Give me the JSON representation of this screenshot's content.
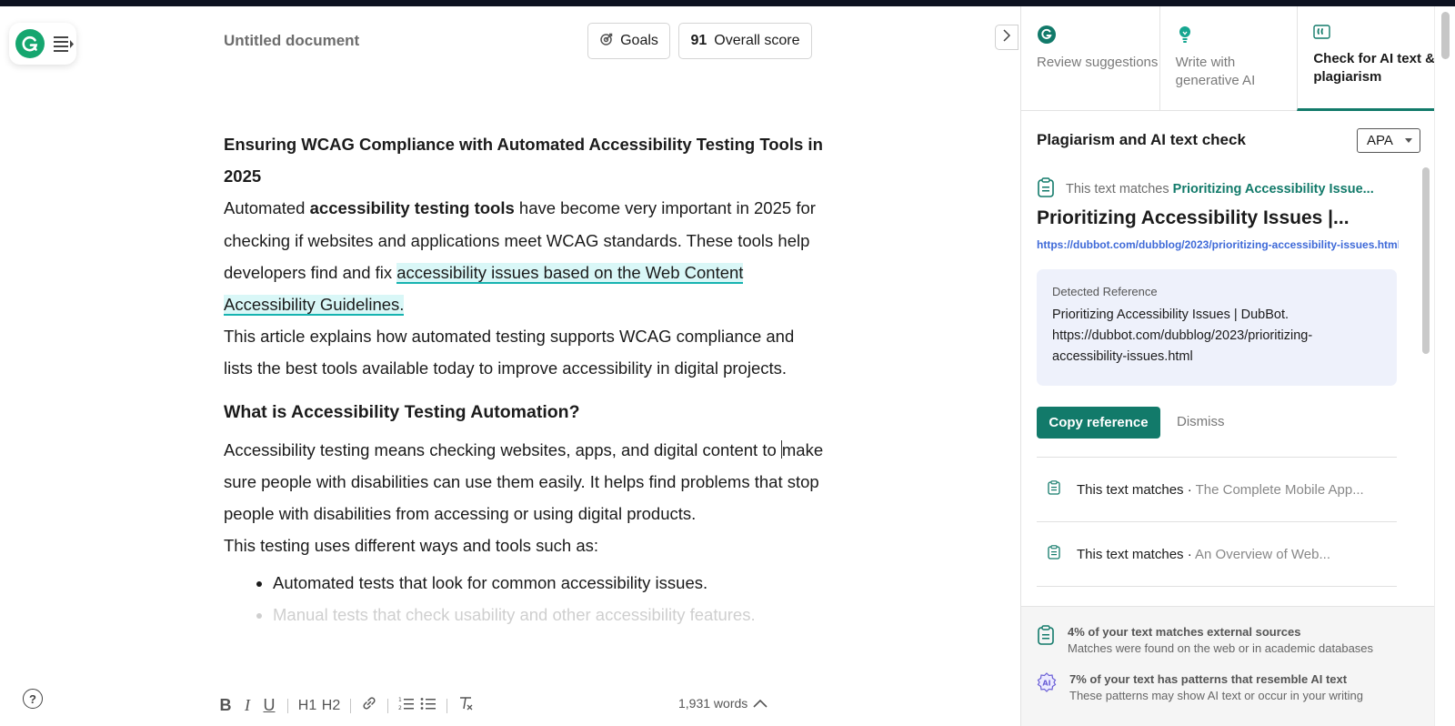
{
  "app": {
    "doc_title": "Untitled document",
    "goals_label": "Goals",
    "score_value": "91",
    "score_label": "Overall score"
  },
  "document": {
    "heading1": "Ensuring WCAG Compliance with Automated Accessibility Testing Tools in 2025",
    "p1_before": "Automated ",
    "p1_bold": "accessibility testing tools",
    "p1_middle": " have become very important in 2025 for checking if websites and applications meet WCAG standards. These tools help developers find and fix ",
    "p1_highlight": "accessibility issues based on the Web Content Accessibility Guidelines.",
    "p2": "This article explains how automated testing supports WCAG compliance and lists the best tools available today to improve accessibility in digital projects.",
    "heading2": "What is Accessibility Testing Automation?",
    "p3_before_cursor": "Accessibility testing means checking websites, apps, and digital content to ",
    "p3_after_cursor": "make sure people with disabilities can use them easily. It helps find problems that stop people with disabilities from accessing or using digital products.",
    "p4": "This testing uses different ways and tools such as:",
    "bullets": [
      "Automated tests that look for common accessibility issues.",
      "Manual tests that check usability and other accessibility features."
    ]
  },
  "toolbar": {
    "bold": "B",
    "italic": "I",
    "underline": "U",
    "h1": "H1",
    "h2": "H2",
    "word_count": "1,931 words"
  },
  "help": {
    "label": "?"
  },
  "panel": {
    "tabs": [
      {
        "label": "Review suggestions",
        "icon": "grammarly-g-icon"
      },
      {
        "label": "Write with generative AI",
        "icon": "lightbulb-icon"
      },
      {
        "label": "Check for AI text & plagiarism",
        "icon": "quote-icon",
        "active": true
      }
    ],
    "title": "Plagiarism and AI text check",
    "citation_style": "APA",
    "active_match": {
      "prefix": "This text matches ",
      "source": "Prioritizing Accessibility Issue...",
      "title": "Prioritizing Accessibility Issues |...",
      "url": "https://dubbot.com/dubblog/2023/prioritizing-accessibility-issues.html",
      "ref_label": "Detected Reference",
      "ref_text": "Prioritizing Accessibility Issues | DubBot. https://dubbot.com/dubblog/2023/prioritizing-accessibility-issues.html",
      "copy_label": "Copy reference",
      "dismiss_label": "Dismiss"
    },
    "other_matches": [
      {
        "prefix": "This text matches · ",
        "source": "The Complete Mobile App..."
      },
      {
        "prefix": "This text matches · ",
        "source": "An Overview of Web..."
      }
    ],
    "stats": [
      {
        "headline": "4% of your text matches external sources",
        "detail": "Matches were found on the web or in academic databases",
        "icon": "clipboard-icon"
      },
      {
        "headline": "7% of your text has patterns that resemble AI text",
        "detail": "These patterns may show AI text or occur in your writing",
        "icon": "ai-badge-icon"
      }
    ]
  },
  "colors": {
    "brand_green": "#15a66f",
    "accent_teal": "#127a6a",
    "highlight_bg": "#d9f7f7",
    "link_blue": "#3f6ad8"
  }
}
